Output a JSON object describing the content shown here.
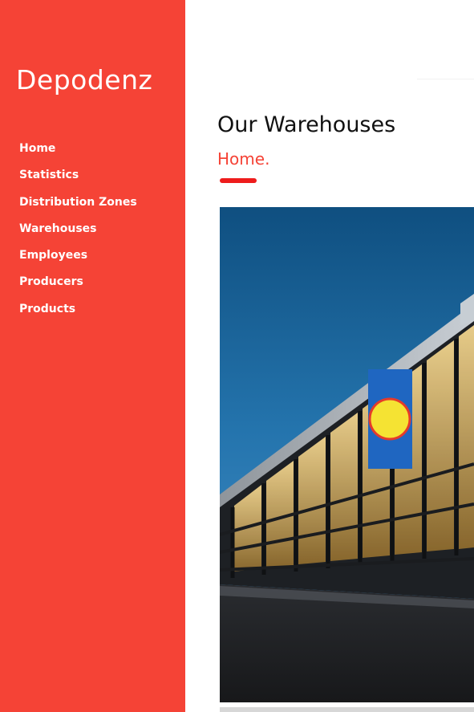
{
  "brand": {
    "name": "Depodenz"
  },
  "nav": {
    "items": [
      {
        "label": "Home"
      },
      {
        "label": "Statistics"
      },
      {
        "label": "Distribution Zones"
      },
      {
        "label": "Warehouses"
      },
      {
        "label": "Employees"
      },
      {
        "label": "Producers"
      },
      {
        "label": "Products"
      }
    ]
  },
  "page": {
    "title": "Our Warehouses",
    "breadcrumb": "Home."
  },
  "colors": {
    "sidebar": "#f54336",
    "accent": "#ee1c1c",
    "heading": "#111111"
  }
}
